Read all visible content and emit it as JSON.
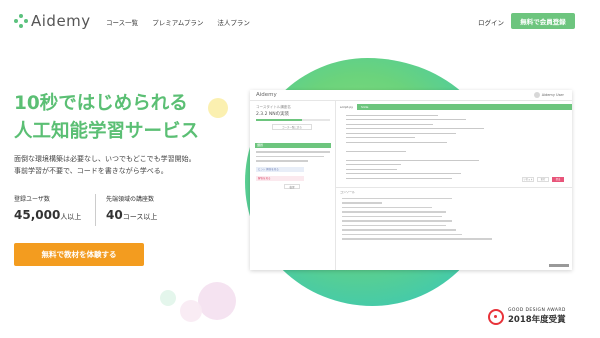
{
  "header": {
    "logo_text": "Aidemy",
    "nav": [
      "コース一覧",
      "プレミアムプラン",
      "法人プラン"
    ],
    "login": "ログイン",
    "signup": "無料で会員登録"
  },
  "hero": {
    "title_line1": "10秒ではじめられる",
    "title_line2": "人工知能学習サービス",
    "desc_line1": "面倒な環境構築は必要なし、いつでもどこでも学習開始。",
    "desc_line2": "事前学習が不要で、コードを書きながら学べる。",
    "stats": [
      {
        "label": "登録ユーザ数",
        "value": "45,000",
        "unit": "人以上"
      },
      {
        "label": "先端領域の講座数",
        "value": "40",
        "unit": "コース以上"
      }
    ],
    "cta": "無料で教材を体験する"
  },
  "mockup": {
    "logo": "Aidemy",
    "user_name": "Aidemy User",
    "course_label": "コースタイトル講座名",
    "section_label": "2.3.2 NNの実装",
    "back_button": "コース一覧に戻る",
    "task_label": "課題",
    "hint_label": "ヒント 解答を見る",
    "answer_label": "解答を見る",
    "review_button": "復習",
    "tab_editor": "script.py",
    "tab_output": "Slide",
    "console_tab": "コンソール",
    "btn_reset": "リセット",
    "btn_run": "実行",
    "btn_submit": "提出",
    "progress": 0.62
  },
  "award": {
    "line1": "GOOD DESIGN AWARD",
    "line2": "2018年度受賞",
    "color": "#e8333a"
  },
  "colors": {
    "brand_green": "#6dc57e",
    "hero_green": "#5bbf74",
    "cta_orange": "#f39c1f"
  }
}
